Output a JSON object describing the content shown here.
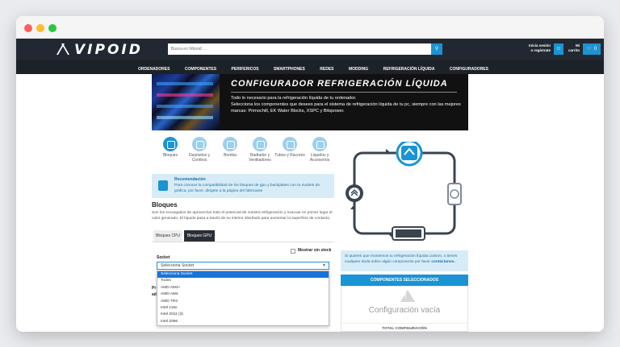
{
  "header": {
    "logo": "VIPOID",
    "search_placeholder": "Busca en Wipoid ...",
    "search_icon": "search-icon",
    "account_line1": "Inicia sesión",
    "account_line2": "o regístrate",
    "cart_line1": "Mi",
    "cart_line2": "carrito",
    "cart_count": "0"
  },
  "nav": {
    "items": [
      "ORDENADORES",
      "COMPONENTES",
      "PERIFERICOS",
      "SMARTPHONES",
      "REDES",
      "MODDING",
      "REFRIGERACIÓN LÍQUIDA",
      "CONFIGURADORES"
    ]
  },
  "banner": {
    "title": "CONFIGURADOR REFRIGERACIÓN LÍQUIDA",
    "line1": "Todo lo necesario para la refrigeración líquida de tu ordenador.",
    "line2": "Selecciona los componentes que desees para el sistema de refrigeración líquida de tu pc, siempre con las mejores marcas: Primochill, EK Water Blocks, XSPC y Bitspower."
  },
  "categories": [
    {
      "label": "Bloques",
      "icon": "cpu-block-icon"
    },
    {
      "label": "Depósitos y Combos",
      "icon": "reservoir-icon"
    },
    {
      "label": "Bomba",
      "icon": "pump-icon"
    },
    {
      "label": "Radiador y Ventiladores",
      "icon": "radiator-icon"
    },
    {
      "label": "Tubos y Racores",
      "icon": "tube-icon"
    },
    {
      "label": "Líquidos y Accesorios",
      "icon": "liquid-icon"
    }
  ],
  "note": {
    "title": "Recomendación",
    "text": "Para conocer la compatibilidad de los bloques de gpu y backplates con tu modelo de gráfica, por favor, dirígete a la página del fabricante"
  },
  "section": {
    "title": "Bloques",
    "text": "Son los encargados de aprovechar todo el potencial de nuestra refrigeración y evacuar en primer lugar el calor generado. El líquido pasa a través de su interior diseñado para aumentar la superficie de contacto."
  },
  "tabs": [
    "Bloques CPU",
    "Bloques GPU"
  ],
  "filter": {
    "show_stock": "Mostrar sin stock",
    "socket_label": "Socket",
    "selected": "Selecciona Socket",
    "options": [
      "Selecciona Socket",
      "Todos",
      "AMD AM3+",
      "AMD AM4",
      "AMD TR4",
      "Intel 115x",
      "Intel 2011 (3)",
      "Intel 2066"
    ]
  },
  "tail": {
    "line1": "Pr",
    "line2": "ad"
  },
  "info": {
    "text": "Si quieres que montemos tu refrigeración líquida custom, o tienes cualquier duda sobre algún componente por favor",
    "link": "contáctanos."
  },
  "summary": {
    "header": "COMPONENTES SELECCIONADOS",
    "empty": "Configuración vacía",
    "total": "TOTAL CONFIGURACIÓN"
  },
  "colors": {
    "accent": "#1a94d4",
    "header_bg": "#222831",
    "nav_bg": "#1d2228",
    "info_bg": "#d8ecf7"
  }
}
